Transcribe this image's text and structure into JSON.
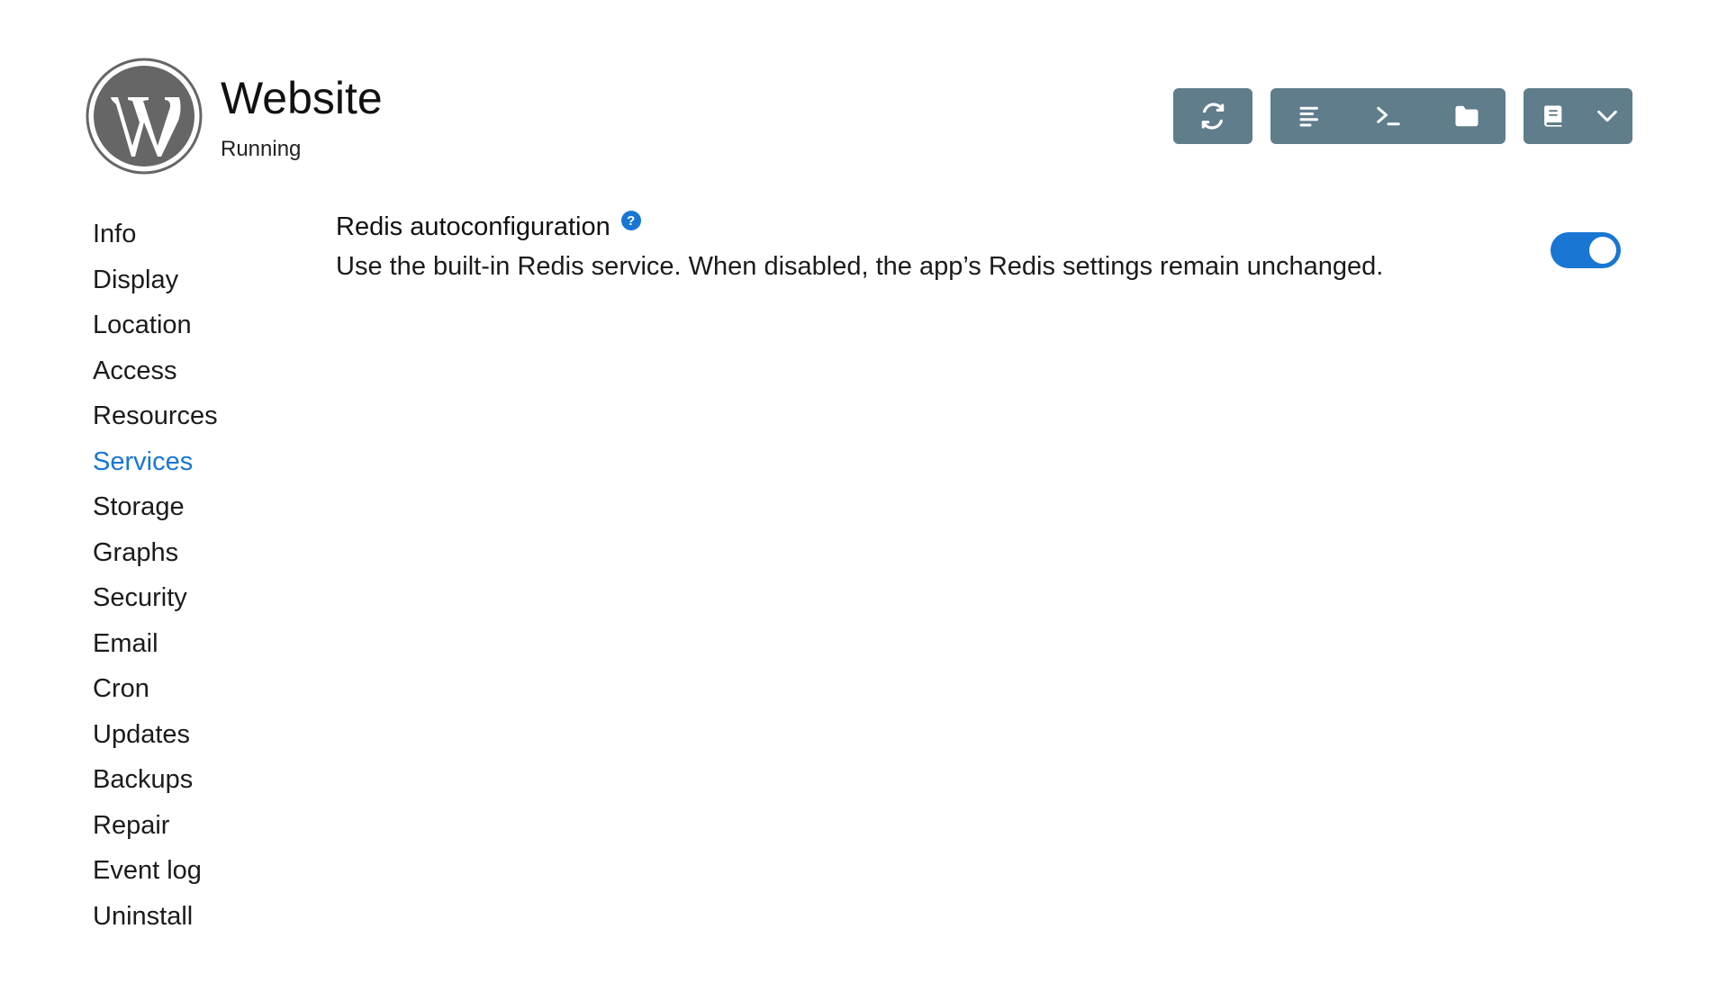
{
  "app": {
    "title": "Website",
    "status": "Running",
    "logo_icon": "wordpress-logo-icon"
  },
  "toolbar": {
    "buttons": [
      {
        "icon": "restart-icon",
        "label": ""
      },
      {
        "icon": "logs-icon",
        "label": ""
      },
      {
        "icon": "terminal-icon",
        "label": ""
      },
      {
        "icon": "folder-icon",
        "label": ""
      },
      {
        "icon": "book-icon",
        "label": ""
      },
      {
        "icon": "chevron-down-icon",
        "label": ""
      }
    ],
    "color": "#607d8b"
  },
  "sidebar": {
    "items": [
      {
        "label": "Info"
      },
      {
        "label": "Display"
      },
      {
        "label": "Location"
      },
      {
        "label": "Access"
      },
      {
        "label": "Resources"
      },
      {
        "label": "Services",
        "active": true
      },
      {
        "label": "Storage"
      },
      {
        "label": "Graphs"
      },
      {
        "label": "Security"
      },
      {
        "label": "Email"
      },
      {
        "label": "Cron"
      },
      {
        "label": "Updates"
      },
      {
        "label": "Backups"
      },
      {
        "label": "Repair"
      },
      {
        "label": "Event log"
      },
      {
        "label": "Uninstall"
      }
    ],
    "active_color": "#1976d2"
  },
  "services": {
    "redis": {
      "title": "Redis autoconfiguration",
      "help_symbol": "?",
      "description": "Use the built-in Redis service. When disabled, the app’s Redis settings remain unchanged.",
      "enabled": true
    }
  }
}
